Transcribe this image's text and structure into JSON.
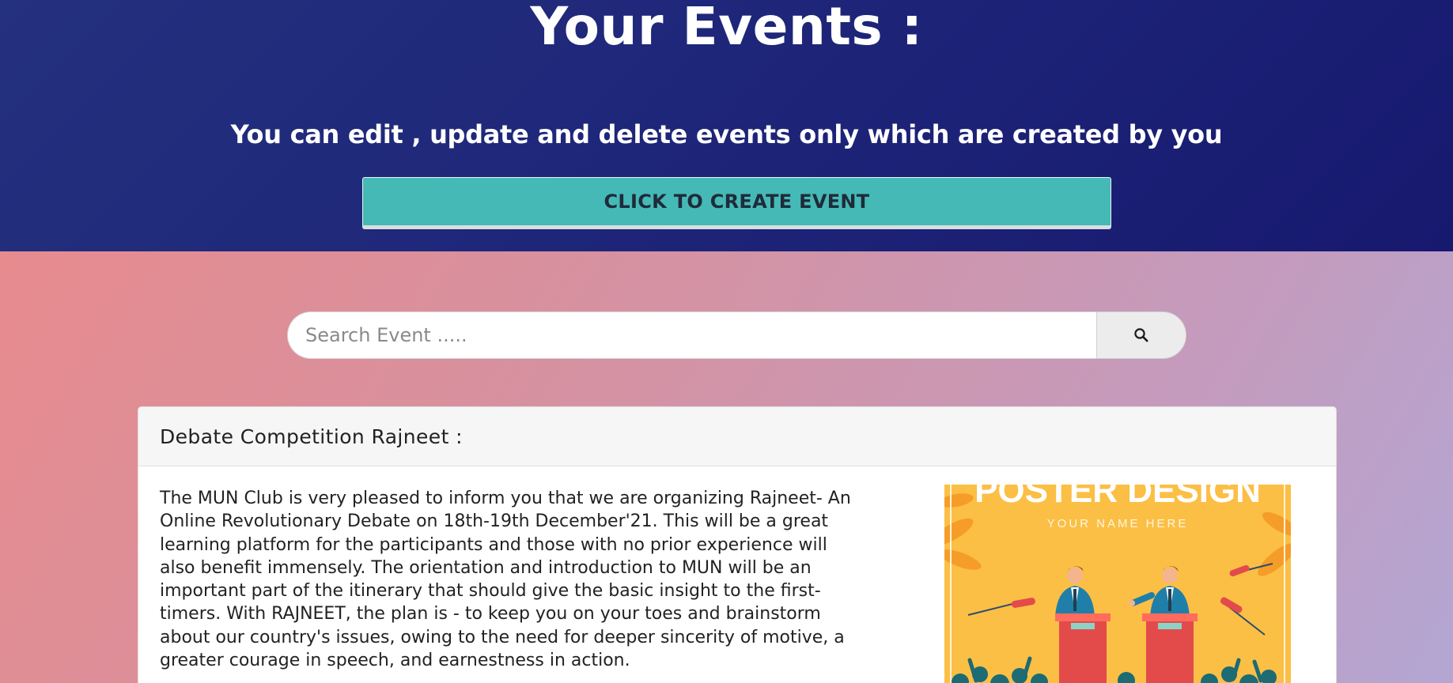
{
  "header": {
    "title": "Your Events :",
    "subtitle": "You can edit , update and delete events only which are created by you",
    "create_button_label": "CLICK TO CREATE EVENT"
  },
  "search": {
    "placeholder": "Search Event .....",
    "value": ""
  },
  "event": {
    "title": "Debate Competition Rajneet :",
    "description": "The MUN Club is very pleased to inform you that we are organizing Rajneet- An Online Revolutionary Debate on 18th-19th December'21. This will be a great learning platform for the participants and those with no prior experience will also benefit immensely. The orientation and introduction to MUN will be an important part of the itinerary that should give the basic insight to the first-timers. With RAJNEET, the plan is - to keep you on your toes and brainstorm about our country's issues, owing to the need for deeper sincerity of motive, a greater courage in speech, and earnestness in action.",
    "poster": {
      "heading": "POSTER DESIGN",
      "subheading": "YOUR NAME HERE"
    }
  },
  "colors": {
    "hero_bg": "#1d2478",
    "button_bg": "#45b9b5",
    "lower_bg_start": "#e78b8e",
    "lower_bg_end": "#b3a6d3",
    "poster_bg": "#fbbf45"
  },
  "icons": {
    "search_button": "search-icon"
  }
}
